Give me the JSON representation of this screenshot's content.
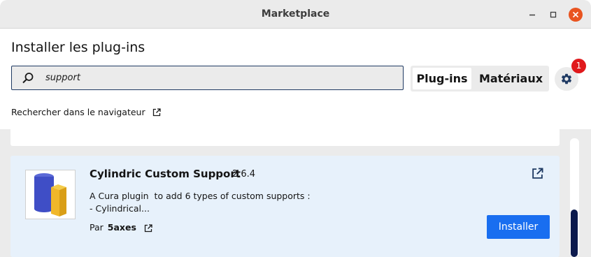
{
  "window": {
    "title": "Marketplace",
    "close_color": "#e95420"
  },
  "header": {
    "heading": "Installer les plug-ins",
    "search": {
      "value": "support",
      "icon": "search-icon"
    },
    "tabs": [
      {
        "label": "Plug-ins",
        "active": true
      },
      {
        "label": "Matériaux",
        "active": false
      }
    ],
    "settings": {
      "icon": "gear-icon",
      "badge": "1",
      "badge_color": "#e0191c"
    },
    "browser_link": {
      "label": "Rechercher dans le navigateur",
      "icon": "external-link-icon"
    }
  },
  "plugins": [
    {
      "name": "Cylindric Custom Support",
      "version": "2.6.4",
      "description_line1": "A Cura plugin  to add 6 types of custom supports :",
      "description_line2": "- Cylindrical...",
      "by_label": "Par",
      "author": "5axes",
      "install_label": "Installer",
      "install_color": "#196ef0"
    }
  ]
}
